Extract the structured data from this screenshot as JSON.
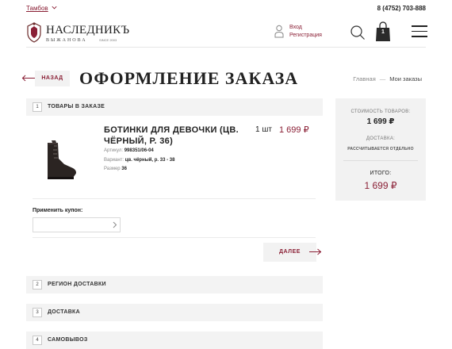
{
  "topbar": {
    "city": "Тамбов",
    "phone": "8 (4752) 703-888"
  },
  "header": {
    "logo_name": "НАСЛЕДНИКЪ",
    "logo_sub": "ВЫЖАНОВА",
    "logo_since": "SINCE 2003",
    "login": "Вход",
    "register": "Регистрация",
    "cart_count": "1"
  },
  "page": {
    "back_label": "НАЗАД",
    "title": "ОФОРМЛЕНИЕ ЗАКАЗА",
    "breadcrumbs": [
      "Главная",
      "Мои заказы"
    ],
    "breadcrumb_sep": "—"
  },
  "sections": [
    {
      "num": "1",
      "title": "ТОВАРЫ В ЗАКАЗЕ"
    },
    {
      "num": "2",
      "title": "РЕГИОН ДОСТАВКИ"
    },
    {
      "num": "3",
      "title": "ДОСТАВКА"
    },
    {
      "num": "4",
      "title": "САМОВЫВОЗ"
    }
  ],
  "product": {
    "name": "БОТИНКИ ДЛЯ ДЕВОЧКИ (ЦВ. ЧЁРНЫЙ, Р. 36)",
    "qty": "1 шт",
    "price": "1 699 ₽",
    "meta": [
      {
        "label": "Артикул:",
        "value": "998351/06-04"
      },
      {
        "label": "Вариант:",
        "value": "цв. чёрный, р. 33 - 38"
      },
      {
        "label": "Размер",
        "value": "36"
      }
    ]
  },
  "coupon": {
    "label": "Применить купон:",
    "value": "",
    "placeholder": ""
  },
  "next_label": "ДАЛЕЕ",
  "summary": {
    "goods_label": "СТОИМОСТЬ ТОВАРОВ:",
    "goods_value": "1 699 ₽",
    "delivery_label": "ДОСТАВКА:",
    "delivery_value": "РАССЧИТЫВАЕТСЯ ОТДЕЛЬНО",
    "total_label": "ИТОГО:",
    "total_value": "1 699 ₽"
  },
  "colors": {
    "accent": "#8a1f35",
    "panel": "#f2f2f2",
    "text": "#222222"
  },
  "icons": [
    "chevron-down-icon",
    "crest-icon",
    "user-icon",
    "search-icon",
    "bag-icon",
    "burger-icon",
    "arrow-left-icon",
    "chevron-right-icon",
    "arrow-right-icon"
  ]
}
